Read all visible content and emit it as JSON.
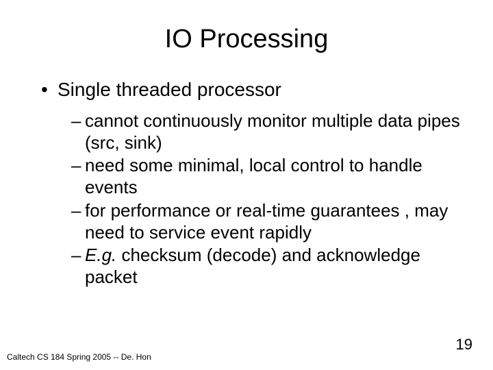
{
  "title": "IO Processing",
  "l1": "Single threaded processor",
  "l2_0": "cannot continuously monitor multiple data pipes (src, sink)",
  "l2_1": "need some minimal, local control to handle events",
  "l2_2": "for performance or real-time guarantees , may need to service event rapidly",
  "l2_3a": "E.g.",
  "l2_3b": " checksum (decode) and acknowledge packet",
  "footer": "Caltech CS 184 Spring 2005 -- De. Hon",
  "pagenum": "19"
}
